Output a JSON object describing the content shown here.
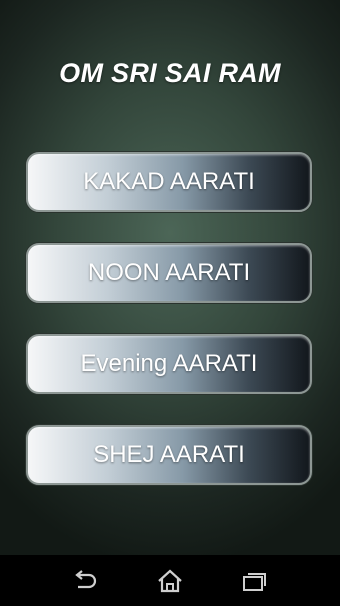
{
  "header": {
    "title": "OM SRI SAI RAM"
  },
  "menu": {
    "buttons": [
      {
        "label": "KAKAD AARATI"
      },
      {
        "label": "NOON AARATI"
      },
      {
        "label": "Evening AARATI"
      },
      {
        "label": "SHEJ AARATI"
      }
    ]
  },
  "navbar": {
    "icons": [
      "back-icon",
      "home-icon",
      "recent-apps-icon"
    ]
  },
  "colors": {
    "background": "#33463b",
    "button_light": "#f6f7f8",
    "button_dark": "#12171c",
    "text": "#ffffff"
  }
}
